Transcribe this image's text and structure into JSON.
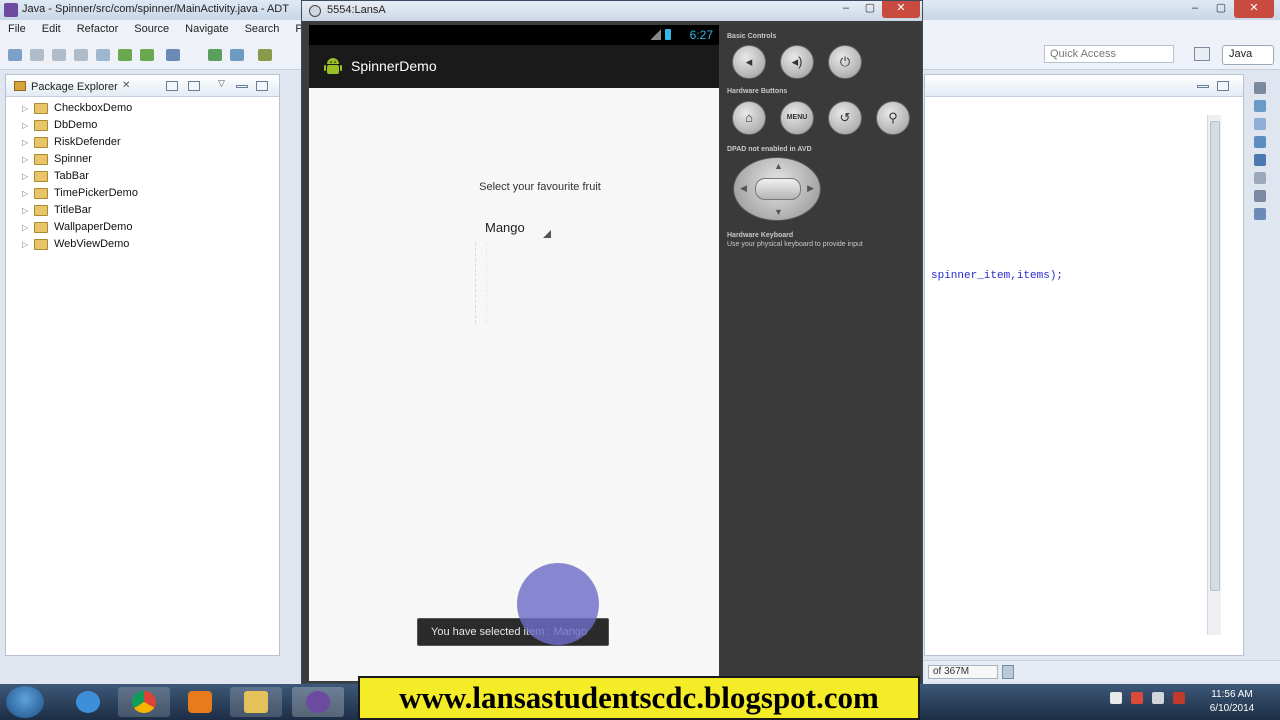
{
  "ide": {
    "title": "Java - Spinner/src/com/spinner/MainActivity.java - ADT",
    "menu": [
      "File",
      "Edit",
      "Refactor",
      "Source",
      "Navigate",
      "Search",
      "Proje"
    ],
    "quick_access_placeholder": "Quick Access",
    "perspective_label": "Java",
    "package_explorer": {
      "tab_label": "Package Explorer",
      "close_glyph": "✕",
      "projects": [
        "CheckboxDemo",
        "DbDemo",
        "RiskDefender",
        "Spinner",
        "TabBar",
        "TimePickerDemo",
        "TitleBar",
        "WallpaperDemo",
        "WebViewDemo"
      ]
    },
    "editor": {
      "code_line": "spinner_item,items);"
    },
    "heap_status": "of 367M"
  },
  "emulator": {
    "window_title": "5554:LansA",
    "status_bar": {
      "time": "6:27"
    },
    "app": {
      "title": "SpinnerDemo",
      "prompt": "Select your favourite fruit",
      "spinner_value": "Mango",
      "toast_text": "You have selected item : Mango"
    },
    "controls": {
      "basic_controls_label": "Basic Controls",
      "hardware_buttons_label": "Hardware Buttons",
      "dpad_label": "DPAD not enabled in AVD",
      "keyboard_label": "Hardware Keyboard",
      "keyboard_note": "Use your physical keyboard to provide input",
      "menu_button_label": "MENU"
    }
  },
  "taskbar": {
    "clock_time": "11:56 AM",
    "clock_date": "6/10/2014"
  },
  "watermark": "www.lansastudentscdc.blogspot.com",
  "colors": {
    "android_accent": "#33b5e5",
    "watermark_bg": "#f3ec27",
    "touch_indicator": "#6e6ec8"
  }
}
